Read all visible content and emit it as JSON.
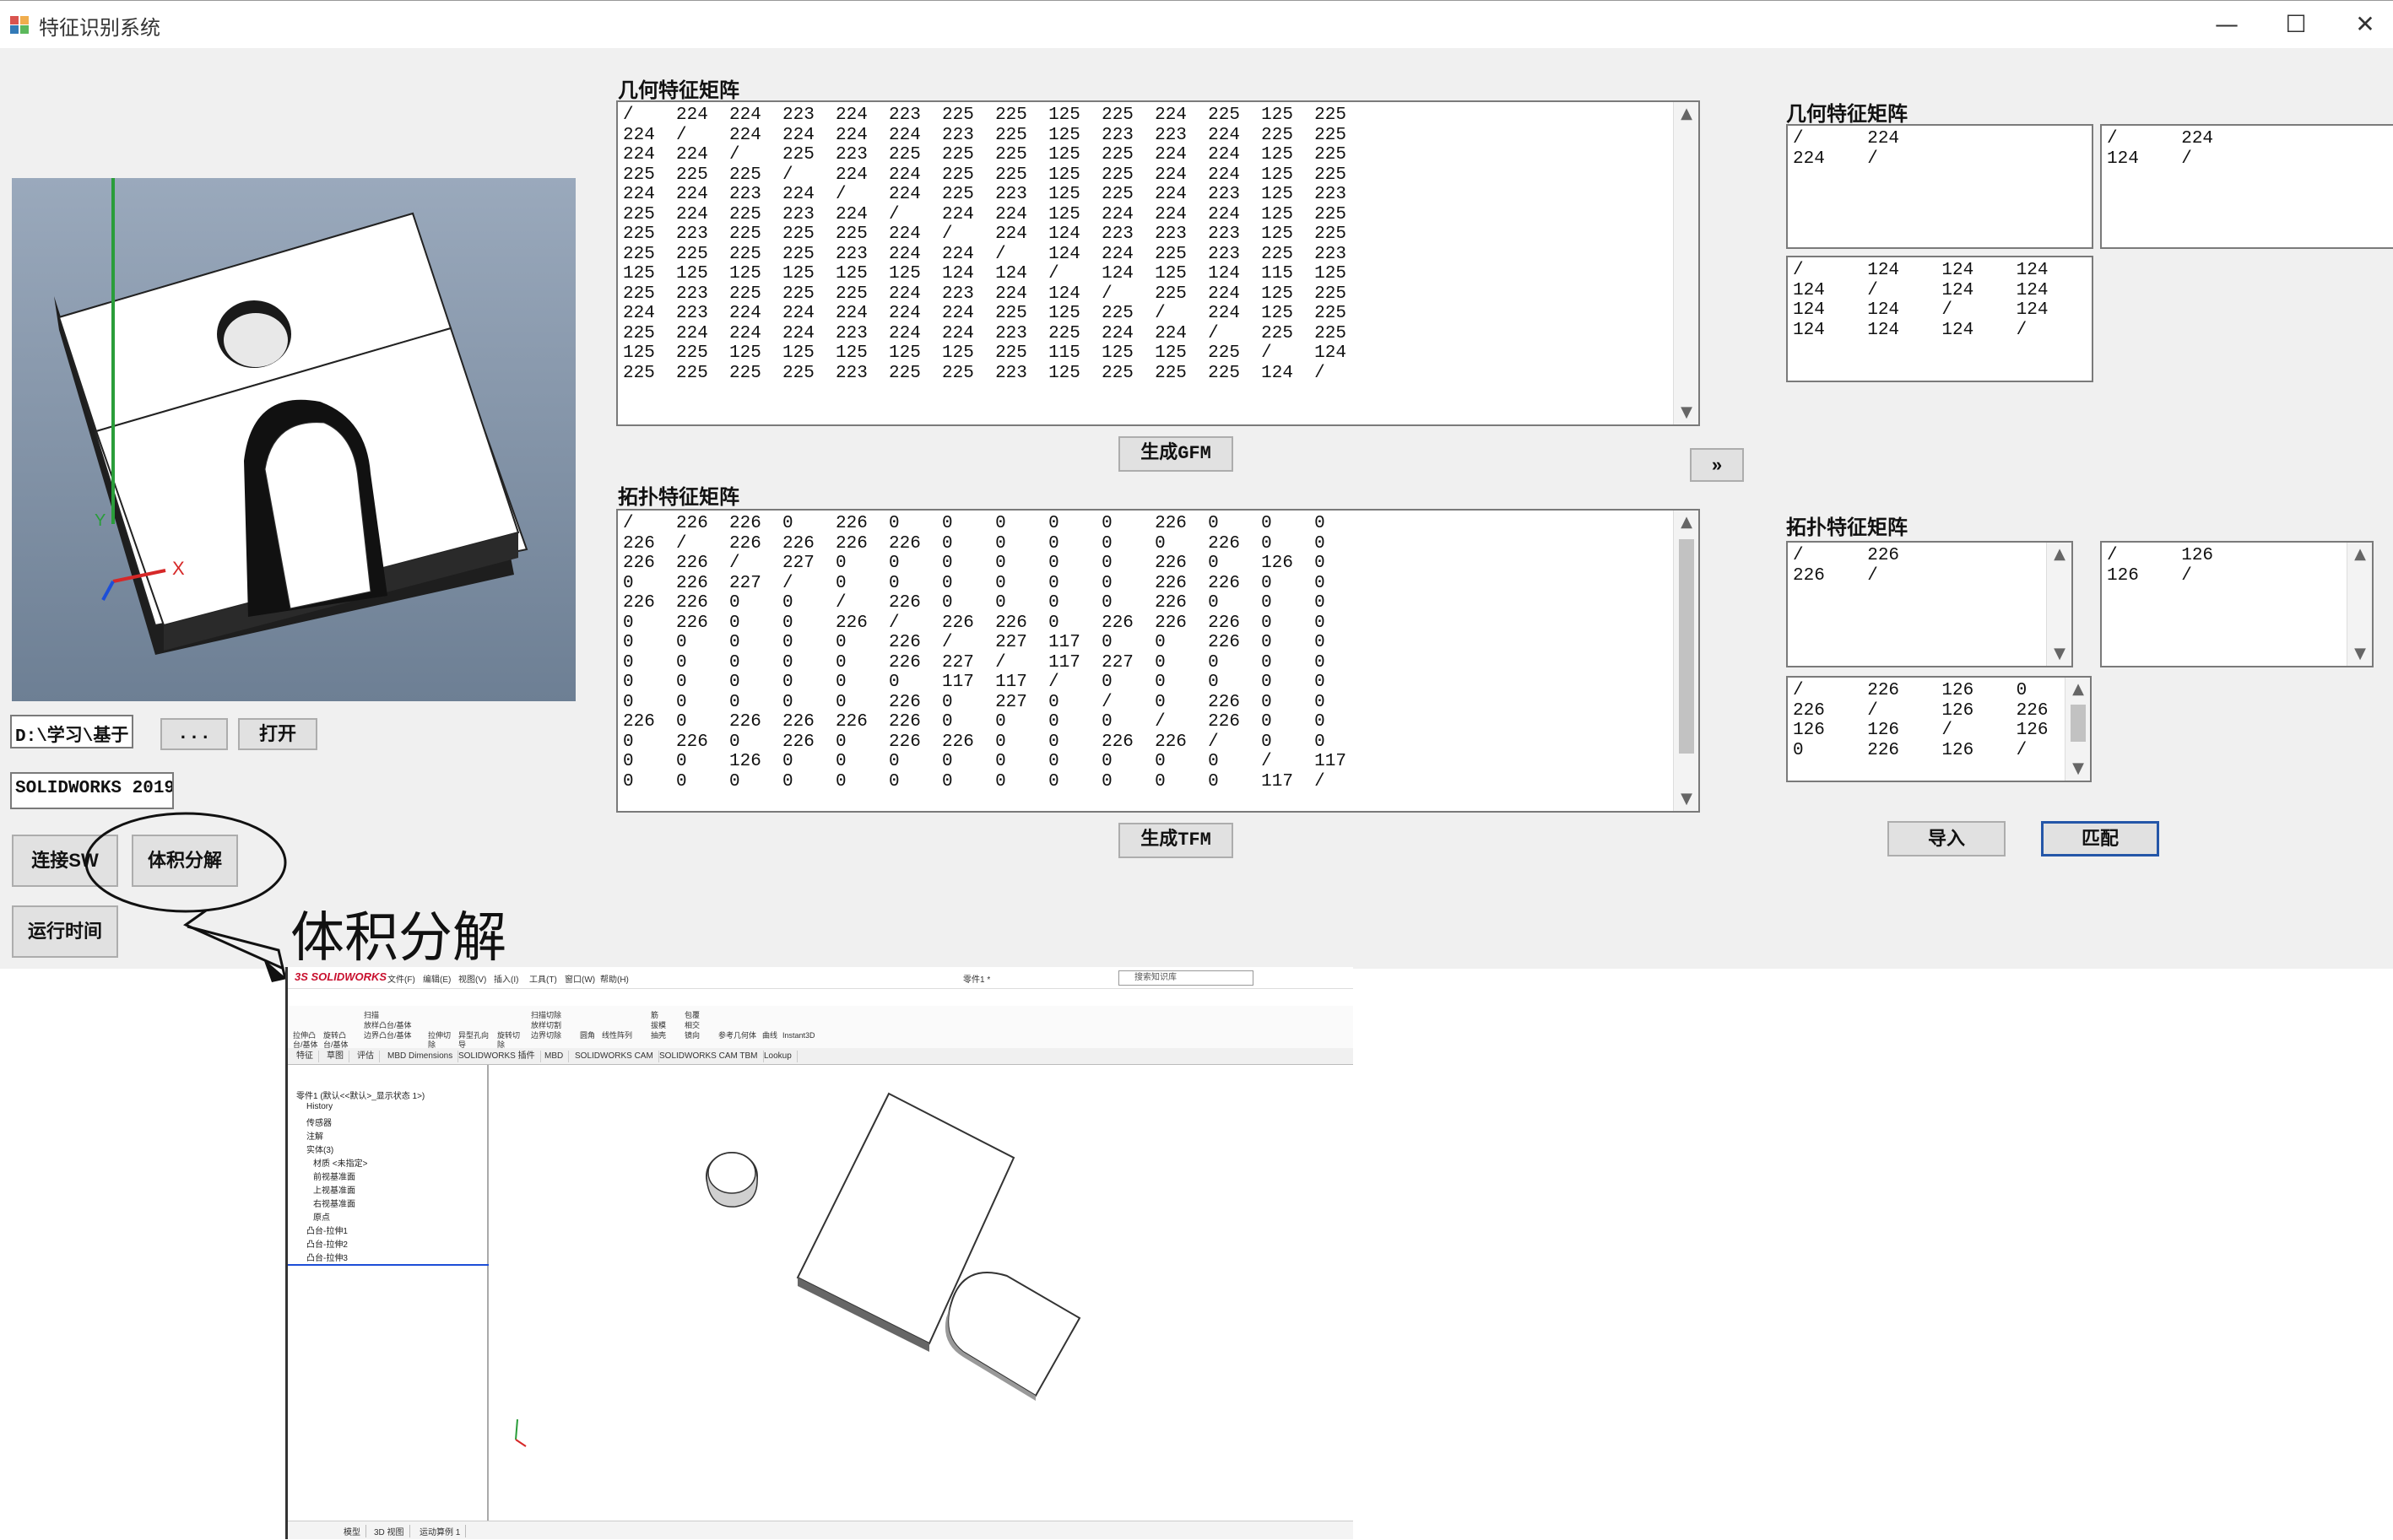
{
  "window": {
    "title": "特征识别系统",
    "controls": [
      "—",
      "☐",
      "✕"
    ]
  },
  "geo_matrix": {
    "label": "几何特征矩阵",
    "rows": [
      "/    224  224  223  224  223  225  225  125  225  224  225  125  225",
      "224  /    224  224  224  224  223  225  125  223  223  224  225  225",
      "224  224  /    225  223  225  225  225  125  225  224  224  125  225",
      "225  225  225  /    224  224  225  225  125  225  224  224  125  225",
      "224  224  223  224  /    224  225  223  125  225  224  223  125  223",
      "225  224  225  223  224  /    224  224  125  224  224  224  125  225",
      "225  223  225  225  225  224  /    224  124  223  223  223  125  225",
      "225  225  225  225  223  224  224  /    124  224  225  223  225  223",
      "125  125  125  125  125  125  124  124  /    124  125  124  115  125",
      "225  223  225  225  225  224  223  224  124  /    225  224  125  225",
      "224  223  224  224  224  224  224  225  125  225  /    224  125  225",
      "225  224  224  224  223  224  224  223  225  224  224  /    225  225",
      "125  225  125  125  125  125  125  225  115  125  125  225  /    124",
      "225  225  225  225  223  225  225  223  125  225  225  225  124  /"
    ]
  },
  "topo_matrix": {
    "label": "拓扑特征矩阵",
    "rows": [
      "/    226  226  0    226  0    0    0    0    0    226  0    0    0",
      "226  /    226  226  226  226  0    0    0    0    0    226  0    0",
      "226  226  /    227  0    0    0    0    0    0    226  0    126  0",
      "0    226  227  /    0    0    0    0    0    0    226  226  0    0",
      "226  226  0    0    /    226  0    0    0    0    226  0    0    0",
      "0    226  0    0    226  /    226  226  0    226  226  226  0    0",
      "0    0    0    0    0    226  /    227  117  0    0    226  0    0",
      "0    0    0    0    0    226  227  /    117  227  0    0    0    0",
      "0    0    0    0    0    0    117  117  /    0    0    0    0    0",
      "0    0    0    0    0    226  0    227  0    /    0    226  0    0",
      "226  0    226  226  226  226  0    0    0    0    /    226  0    0",
      "0    226  0    226  0    226  226  0    0    226  226  /    0    0",
      "0    0    126  0    0    0    0    0    0    0    0    0    /    117",
      "0    0    0    0    0    0    0    0    0    0    0    0    117  /"
    ]
  },
  "buttons": {
    "gen_gfm": "生成GFM",
    "gen_tfm": "生成TFM",
    "arrow": "»",
    "browse": "...",
    "open": "打开",
    "connect_sw": "连接SW",
    "volume_decomp": "体积分解",
    "runtime": "运行时间",
    "import": "导入",
    "match": "匹配"
  },
  "fields": {
    "path": "D:\\学习\\基于",
    "sw_version": "SOLIDWORKS 2019"
  },
  "right_geo": {
    "label": "几何特征矩阵",
    "box1": [
      "/      224",
      "224    /"
    ],
    "box2": [
      "/      224",
      "124    /"
    ],
    "box3": [
      "/      124    124    124",
      "124    /      124    124",
      "124    124    /      124",
      "124    124    124    /"
    ]
  },
  "right_topo": {
    "label": "拓扑特征矩阵",
    "box1": [
      "/      226",
      "226    /"
    ],
    "box2": [
      "/      126",
      "126    /"
    ],
    "box3": [
      "/      226    126    0",
      "226    /      126    226",
      "126    126    /      126",
      "0      226    126    /"
    ]
  },
  "callout": {
    "text": "体积分解"
  },
  "viewport": {
    "axis_y": "Y",
    "axis_x": "X"
  },
  "solidworks": {
    "logo": "3S SOLIDWORKS",
    "menus": [
      "文件(F)",
      "编辑(E)",
      "视图(V)",
      "插入(I)",
      "工具(T)",
      "窗口(W)",
      "帮助(H)"
    ],
    "doc_title": "零件1 *",
    "search_placeholder": "搜索知识库",
    "ribbon_items": [
      "拉伸凸台/基体",
      "旋转凸台/基体",
      "扫描",
      "放样凸台/基体",
      "边界凸台/基体",
      "拉伸切除",
      "异型孔向导",
      "旋转切除",
      "扫描切除",
      "放样切割",
      "边界切除",
      "圆角",
      "线性阵列",
      "筋",
      "拔模",
      "抽壳",
      "包覆",
      "相交",
      "镜向",
      "参考几何体",
      "曲线",
      "Instant3D"
    ],
    "tabs": [
      "特征",
      "草图",
      "评估",
      "MBD Dimensions",
      "SOLIDWORKS 插件",
      "MBD",
      "SOLIDWORKS CAM",
      "SOLIDWORKS CAM TBM",
      "Lookup"
    ],
    "tree": [
      "零件1 (默认<<默认>_显示状态 1>)",
      "History",
      "传感器",
      "注解",
      "实体(3)",
      "材质 <未指定>",
      "前视基准面",
      "上视基准面",
      "右视基准面",
      "原点",
      "凸台-拉伸1",
      "凸台-拉伸2",
      "凸台-拉伸3"
    ],
    "status_tabs": [
      "模型",
      "3D 视图",
      "运动算例 1"
    ]
  },
  "colors": {
    "window_bg": "#f0f0f0",
    "accent": "#2456a8",
    "sw_red": "#c8102e"
  }
}
